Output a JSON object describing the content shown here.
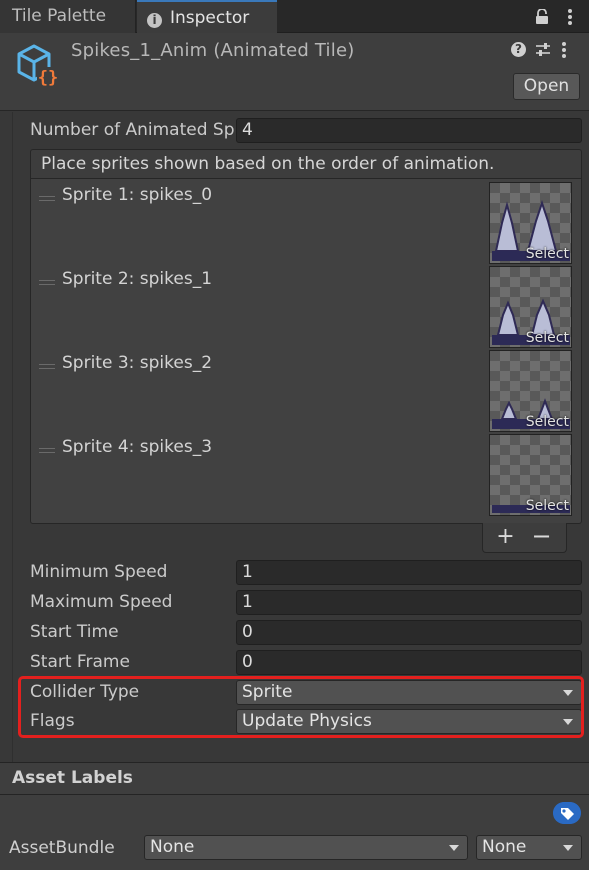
{
  "tabs": [
    {
      "label": "Tile Palette",
      "active": false
    },
    {
      "label": "Inspector",
      "active": true,
      "icon": "info-icon"
    }
  ],
  "header": {
    "title": "Spikes_1_Anim (Animated Tile)",
    "open_label": "Open",
    "icons": [
      "animated-tile-asset-icon",
      "help-icon",
      "settings-icon",
      "more-menu-icon"
    ]
  },
  "fields": {
    "num_frames_label": "Number of Animated Sp",
    "num_frames_value": "4",
    "list_header": "Place sprites shown based on the order of animation.",
    "sprites": [
      {
        "label": "Sprite 1: spikes_0",
        "select": "Select"
      },
      {
        "label": "Sprite 2: spikes_1",
        "select": "Select"
      },
      {
        "label": "Sprite 3: spikes_2",
        "select": "Select"
      },
      {
        "label": "Sprite 4: spikes_3",
        "select": "Select"
      }
    ],
    "add_symbol": "+",
    "remove_symbol": "−",
    "min_speed_label": "Minimum Speed",
    "min_speed_value": "1",
    "max_speed_label": "Maximum Speed",
    "max_speed_value": "1",
    "start_time_label": "Start Time",
    "start_time_value": "0",
    "start_frame_label": "Start Frame",
    "start_frame_value": "0",
    "collider_label": "Collider Type",
    "collider_value": "Sprite",
    "flags_label": "Flags",
    "flags_value": "Update Physics"
  },
  "asset_labels": {
    "title": "Asset Labels",
    "assetbundle_label": "AssetBundle",
    "bundle_value": "None",
    "variant_value": "None"
  },
  "colors": {
    "highlight": "#e3201e",
    "accent": "#3a79bb",
    "tag": "#2a6ac4"
  }
}
